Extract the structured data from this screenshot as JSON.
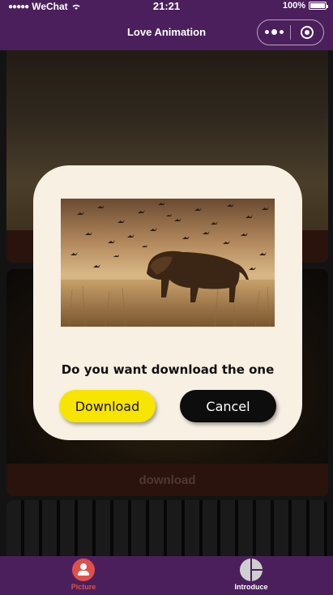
{
  "status_bar": {
    "carrier": "WeChat",
    "time": "21:21",
    "battery": "100%"
  },
  "nav": {
    "title": "Love Animation"
  },
  "list": {
    "download_label": "download"
  },
  "dialog": {
    "question": "Do you want download the one",
    "download_button": "Download",
    "cancel_button": "Cancel"
  },
  "tabbar": {
    "tabs": [
      {
        "label": "Picture",
        "icon": "person-icon",
        "active": true,
        "color": "#e0504a"
      },
      {
        "label": "Introduce",
        "icon": "pie-chart-icon",
        "active": false,
        "color": "#ffffff"
      }
    ]
  },
  "colors": {
    "nav_bg": "#4b1f5c",
    "dialog_bg": "#f7f0e3",
    "download_btn": "#f7e500",
    "cancel_btn": "#0d0d0d",
    "card_footer": "#5b2a1c"
  }
}
